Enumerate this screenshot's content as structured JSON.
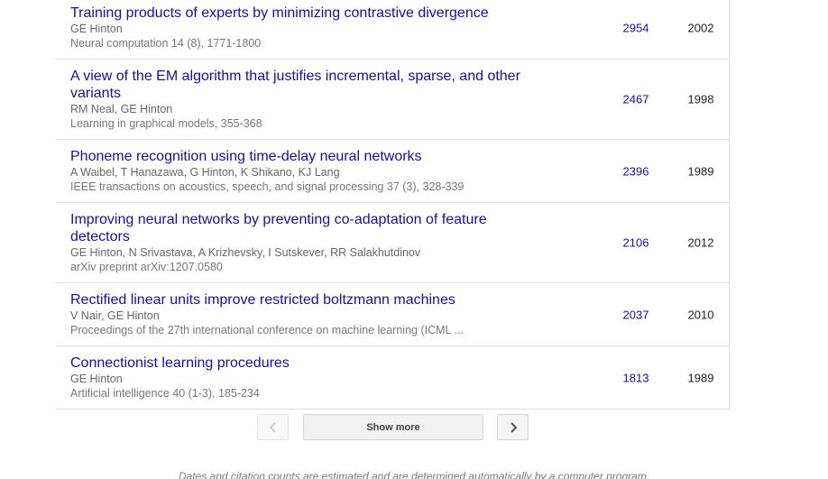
{
  "articles": [
    {
      "title": "Training products of experts by minimizing contrastive divergence",
      "authors": "GE Hinton",
      "venue": "Neural computation 14 (8), 1771-1800",
      "cited_by": "2954",
      "year": "2002"
    },
    {
      "title": "A view of the EM algorithm that justifies incremental, sparse, and other variants",
      "authors": "RM Neal, GE Hinton",
      "venue": "Learning in graphical models, 355-368",
      "cited_by": "2467",
      "year": "1998"
    },
    {
      "title": "Phoneme recognition using time-delay neural networks",
      "authors": "A Waibel, T Hanazawa, G Hinton, K Shikano, KJ Lang",
      "venue": "IEEE transactions on acoustics, speech, and signal processing 37 (3), 328-339",
      "cited_by": "2396",
      "year": "1989"
    },
    {
      "title": "Improving neural networks by preventing co-adaptation of feature detectors",
      "authors": "GE Hinton, N Srivastava, A Krizhevsky, I Sutskever, RR Salakhutdinov",
      "venue": "arXiv preprint arXiv:1207.0580",
      "cited_by": "2106",
      "year": "2012"
    },
    {
      "title": "Rectified linear units improve restricted boltzmann machines",
      "authors": "V Nair, GE Hinton",
      "venue": "Proceedings of the 27th international conference on machine learning (ICML ...",
      "cited_by": "2037",
      "year": "2010"
    },
    {
      "title": "Connectionist learning procedures",
      "authors": "GE Hinton",
      "venue": "Artificial intelligence 40 (1-3), 185-234",
      "cited_by": "1813",
      "year": "1989"
    }
  ],
  "pagination": {
    "prev_icon": "chevron-left-icon",
    "next_icon": "chevron-right-icon",
    "show_more_label": "Show more"
  },
  "footnote": "Dates and citation counts are estimated and are determined automatically by a computer program.",
  "colors": {
    "link": "#1a0dab",
    "meta": "#777777",
    "divider": "#dddddd"
  }
}
